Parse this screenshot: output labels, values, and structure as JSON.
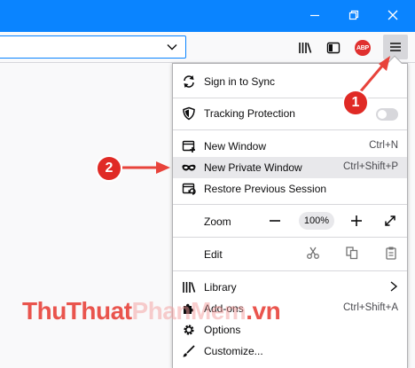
{
  "menu": {
    "sign_in": "Sign in to Sync",
    "tracking": "Tracking Protection",
    "new_window": "New Window",
    "new_window_sc": "Ctrl+N",
    "new_private": "New Private Window",
    "new_private_sc": "Ctrl+Shift+P",
    "restore": "Restore Previous Session",
    "zoom": "Zoom",
    "zoom_value": "100%",
    "edit": "Edit",
    "library": "Library",
    "addons": "Add-ons",
    "addons_sc": "Ctrl+Shift+A",
    "options": "Options",
    "customize": "Customize..."
  },
  "toolbar": {
    "abp_label": "ABP"
  },
  "annotations": {
    "step1": "1",
    "step2": "2"
  },
  "watermark": {
    "part1": "ThuThuat",
    "part2": "PhanMem",
    "part3": ".vn"
  },
  "colors": {
    "titlebar": "#0a84ff",
    "badge": "#e02a25",
    "arrow": "#e8433b"
  }
}
